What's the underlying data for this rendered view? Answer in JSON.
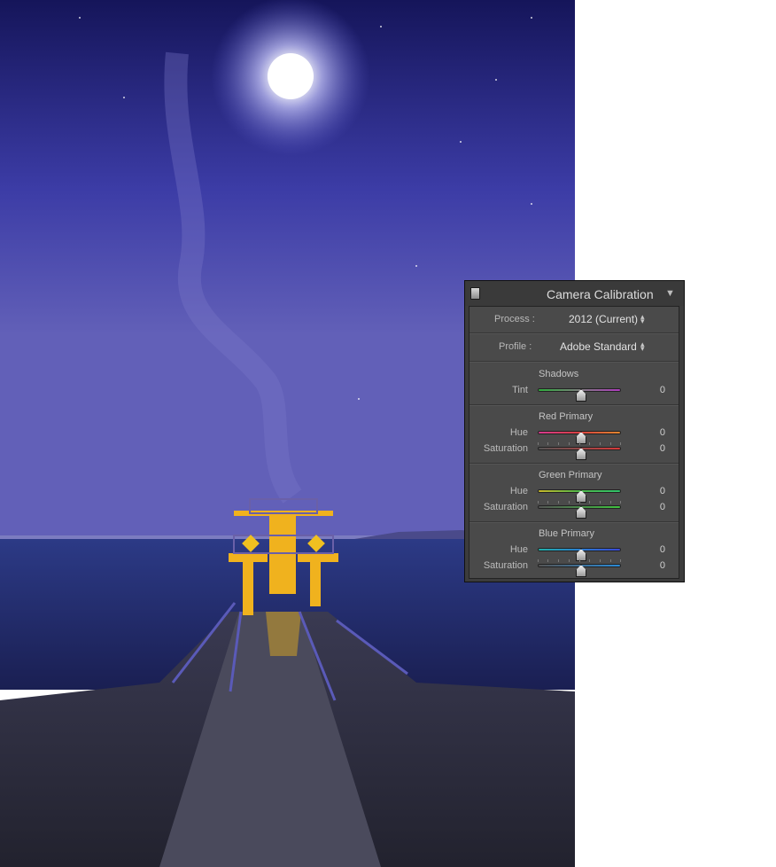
{
  "panel": {
    "title": "Camera Calibration",
    "collapse_glyph": "▼",
    "process": {
      "label": "Process :",
      "value": "2012 (Current)"
    },
    "profile": {
      "label": "Profile :",
      "value": "Adobe Standard"
    },
    "sections": [
      {
        "title": "Shadows",
        "sliders": [
          {
            "label": "Tint",
            "value": "0",
            "gradient": [
              "#2fae3d",
              "#b03cc0"
            ]
          }
        ]
      },
      {
        "title": "Red Primary",
        "sliders": [
          {
            "label": "Hue",
            "value": "0",
            "gradient": [
              "#d63a8f",
              "#e0862e"
            ]
          },
          {
            "label": "Saturation",
            "value": "0",
            "gradient": [
              "#555555",
              "#d63a3a"
            ]
          }
        ]
      },
      {
        "title": "Green Primary",
        "sliders": [
          {
            "label": "Hue",
            "value": "0",
            "gradient": [
              "#c9b82a",
              "#2fc26a"
            ]
          },
          {
            "label": "Saturation",
            "value": "0",
            "gradient": [
              "#555555",
              "#3fc23f"
            ]
          }
        ]
      },
      {
        "title": "Blue Primary",
        "sliders": [
          {
            "label": "Hue",
            "value": "0",
            "gradient": [
              "#22b0a8",
              "#3a48d6"
            ]
          },
          {
            "label": "Saturation",
            "value": "0",
            "gradient": [
              "#555555",
              "#2a8ad6"
            ]
          }
        ]
      }
    ]
  },
  "photo": {
    "subject": "night-pier-moon-photo",
    "sky_color": "#3a3a9a",
    "moon_color": "#ffffff",
    "tower_color": "#f0b21e"
  }
}
